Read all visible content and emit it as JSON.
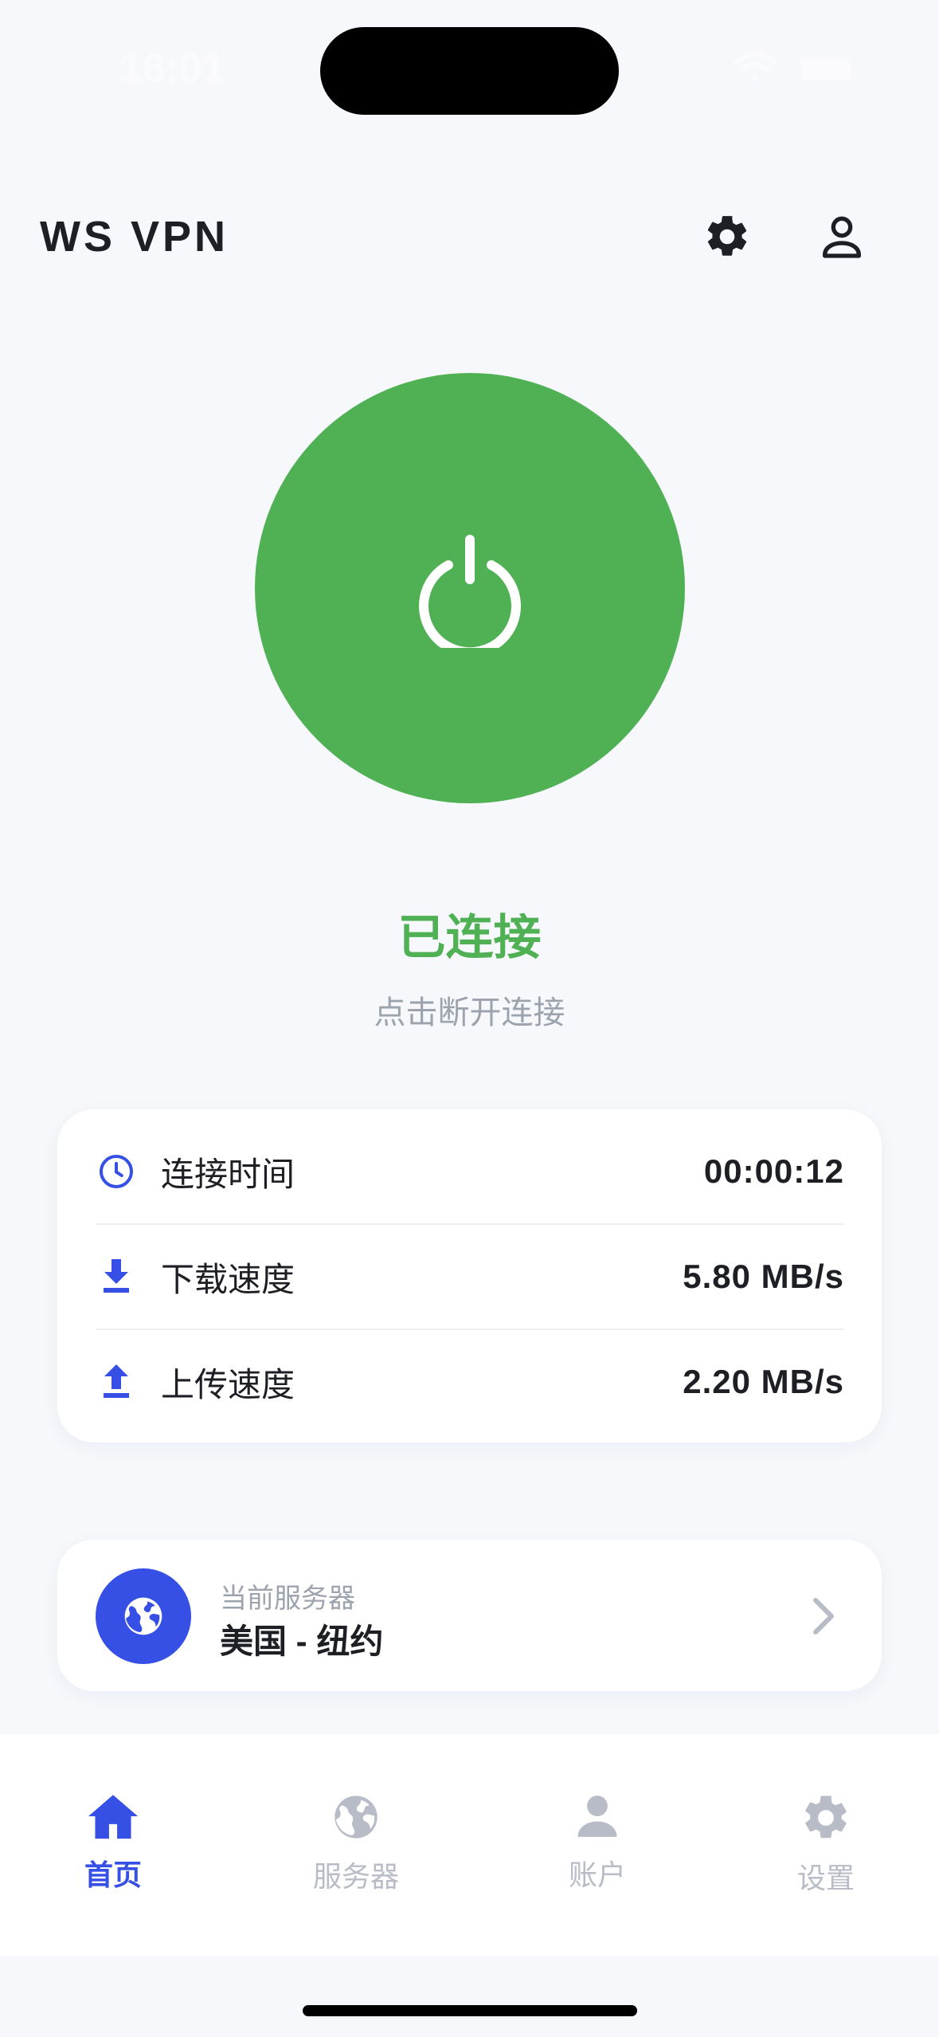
{
  "status_bar": {
    "time": "16:01"
  },
  "header": {
    "title": "WS VPN",
    "settings_icon": "gear-icon",
    "account_icon": "person-icon"
  },
  "connection": {
    "state_label": "已连接",
    "hint": "点击断开连接",
    "connected_color": "#4fb154"
  },
  "stats": [
    {
      "icon": "clock-icon",
      "label": "连接时间",
      "value": "00:00:12"
    },
    {
      "icon": "download-icon",
      "label": "下载速度",
      "value": "5.80 MB/s"
    },
    {
      "icon": "upload-icon",
      "label": "上传速度",
      "value": "2.20 MB/s"
    }
  ],
  "server": {
    "caption": "当前服务器",
    "name": "美国 - 纽约",
    "icon": "globe-icon"
  },
  "tabs": [
    {
      "icon": "home-icon",
      "label": "首页",
      "active": true
    },
    {
      "icon": "globe-icon",
      "label": "服务器",
      "active": false
    },
    {
      "icon": "person-icon",
      "label": "账户",
      "active": false
    },
    {
      "icon": "gear-icon",
      "label": "设置",
      "active": false
    }
  ],
  "colors": {
    "accent": "#3650e6",
    "connected": "#4fb154",
    "muted": "#9ca3ad",
    "background": "#f6f8fc"
  }
}
